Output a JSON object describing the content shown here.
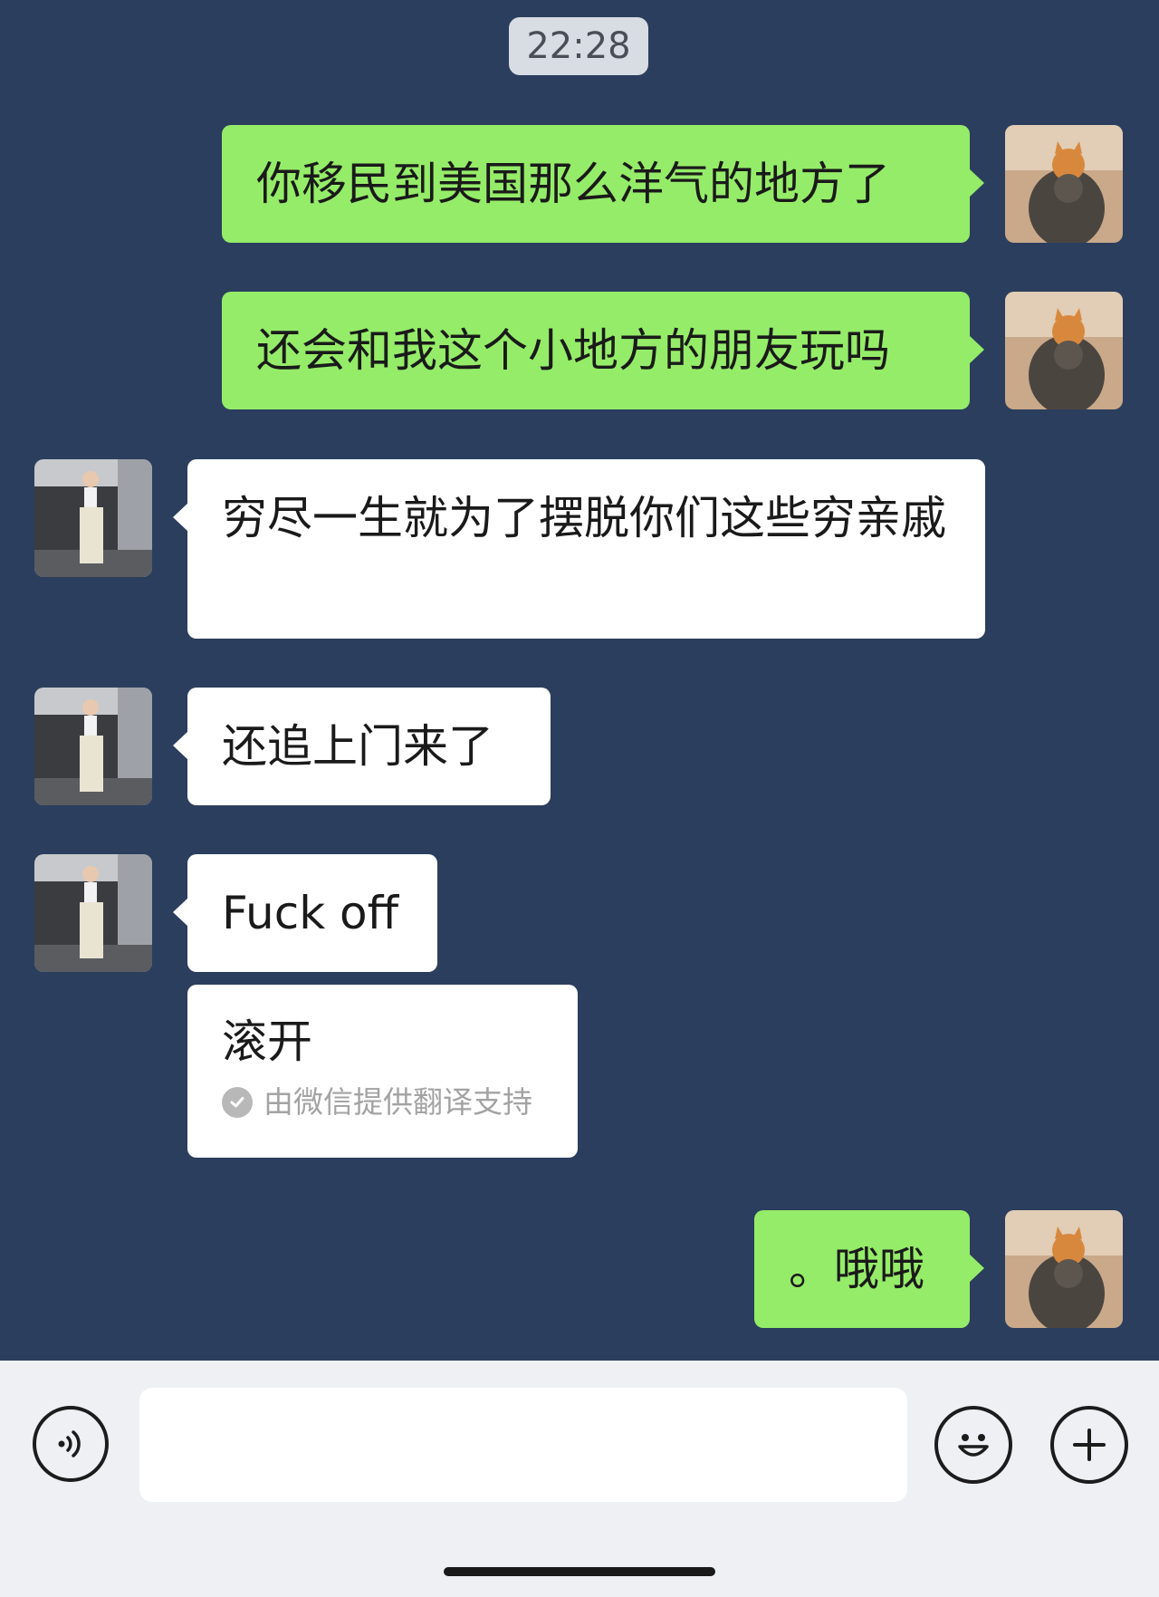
{
  "chat": {
    "timestamp": "22:28",
    "messages": [
      {
        "sender": "me",
        "text": "你移民到美国那么洋气的地方了"
      },
      {
        "sender": "me",
        "text": "还会和我这个小地方的朋友玩吗"
      },
      {
        "sender": "them",
        "text": "穷尽一生就为了摆脱你们这些穷亲戚"
      },
      {
        "sender": "them",
        "text": "还追上门来了"
      },
      {
        "sender": "them",
        "text": "Fuck off"
      },
      {
        "sender": "them",
        "text": "滚开",
        "translation_note": "由微信提供翻译支持"
      },
      {
        "sender": "me",
        "text": "。哦哦"
      }
    ]
  },
  "input_bar": {
    "voice_icon": "voice-icon",
    "emoji_icon": "emoji-icon",
    "plus_icon": "plus-icon",
    "text_value": ""
  },
  "colors": {
    "chat_background": "#2b3e5d",
    "my_bubble": "#95ec69",
    "their_bubble": "#ffffff",
    "input_bar_background": "#eef0f3"
  }
}
